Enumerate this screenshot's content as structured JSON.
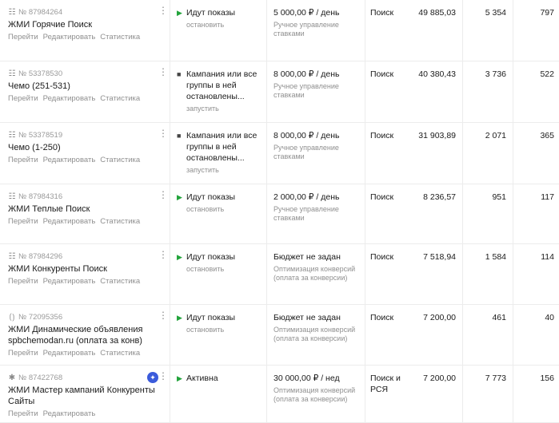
{
  "campaigns": [
    {
      "id": "№ 87984264",
      "icon": "text-ad-icon",
      "name": "ЖМИ Горячие Поиск",
      "links": [
        "Перейти",
        "Редактировать",
        "Статистика"
      ],
      "status": "Идут показы",
      "status_kind": "running",
      "action": "остановить",
      "budget": "5 000,00 ₽ / день",
      "strategy": "Ручное управление ставками",
      "placement": "Поиск",
      "cost": "49 885,03",
      "m1": "5 354",
      "m2": "797"
    },
    {
      "id": "№ 53378530",
      "icon": "text-ad-icon",
      "name": "Чемо (251-531)",
      "links": [
        "Перейти",
        "Редактировать",
        "Статистика"
      ],
      "status": "Кампания или все группы в ней остановлены...",
      "status_kind": "stopped",
      "action": "запустить",
      "budget": "8 000,00 ₽ / день",
      "strategy": "Ручное управление ставками",
      "placement": "Поиск",
      "cost": "40 380,43",
      "m1": "3 736",
      "m2": "522"
    },
    {
      "id": "№ 53378519",
      "icon": "text-ad-icon",
      "name": "Чемо (1-250)",
      "links": [
        "Перейти",
        "Редактировать",
        "Статистика"
      ],
      "status": "Кампания или все группы в ней остановлены...",
      "status_kind": "stopped",
      "action": "запустить",
      "budget": "8 000,00 ₽ / день",
      "strategy": "Ручное управление ставками",
      "placement": "Поиск",
      "cost": "31 903,89",
      "m1": "2 071",
      "m2": "365"
    },
    {
      "id": "№ 87984316",
      "icon": "text-ad-icon",
      "name": "ЖМИ Теплые Поиск",
      "links": [
        "Перейти",
        "Редактировать",
        "Статистика"
      ],
      "status": "Идут показы",
      "status_kind": "running",
      "action": "остановить",
      "budget": "2 000,00 ₽ / день",
      "strategy": "Ручное управление ставками",
      "placement": "Поиск",
      "cost": "8 236,57",
      "m1": "951",
      "m2": "117"
    },
    {
      "id": "№ 87984296",
      "icon": "text-ad-icon",
      "name": "ЖМИ Конкуренты Поиск",
      "links": [
        "Перейти",
        "Редактировать",
        "Статистика"
      ],
      "status": "Идут показы",
      "status_kind": "running",
      "action": "остановить",
      "budget": "Бюджет не задан",
      "strategy": "Оптимизация конверсий (оплата за конверсии)",
      "placement": "Поиск",
      "cost": "7 518,94",
      "m1": "1 584",
      "m2": "114"
    },
    {
      "id": "№ 72095356",
      "icon": "dynamic-ad-icon",
      "name": "ЖМИ Динамические объявления spbchemodan.ru (оплата за конв)",
      "links": [
        "Перейти",
        "Редактировать",
        "Статистика"
      ],
      "status": "Идут показы",
      "status_kind": "running",
      "action": "остановить",
      "budget": "Бюджет не задан",
      "strategy": "Оптимизация конверсий (оплата за конверсии)",
      "placement": "Поиск",
      "cost": "7 200,00",
      "m1": "461",
      "m2": "40"
    },
    {
      "id": "№ 87422768",
      "icon": "master-campaign-icon",
      "name": "ЖМИ Мастер кампаний Конкуренты Сайты",
      "links": [
        "Перейти",
        "Редактировать"
      ],
      "status": "Активна",
      "status_kind": "running",
      "action": "",
      "budget": "30 000,00 ₽ / нед",
      "strategy": "Оптимизация конверсий (оплата за конверсии)",
      "placement": "Поиск и РСЯ",
      "cost": "7 200,00",
      "m1": "7 773",
      "m2": "156",
      "badge": true
    }
  ],
  "colors": {
    "running": "#22a33b",
    "stopped": "#444444",
    "badge": "#3b5bdb",
    "muted": "#909090"
  }
}
